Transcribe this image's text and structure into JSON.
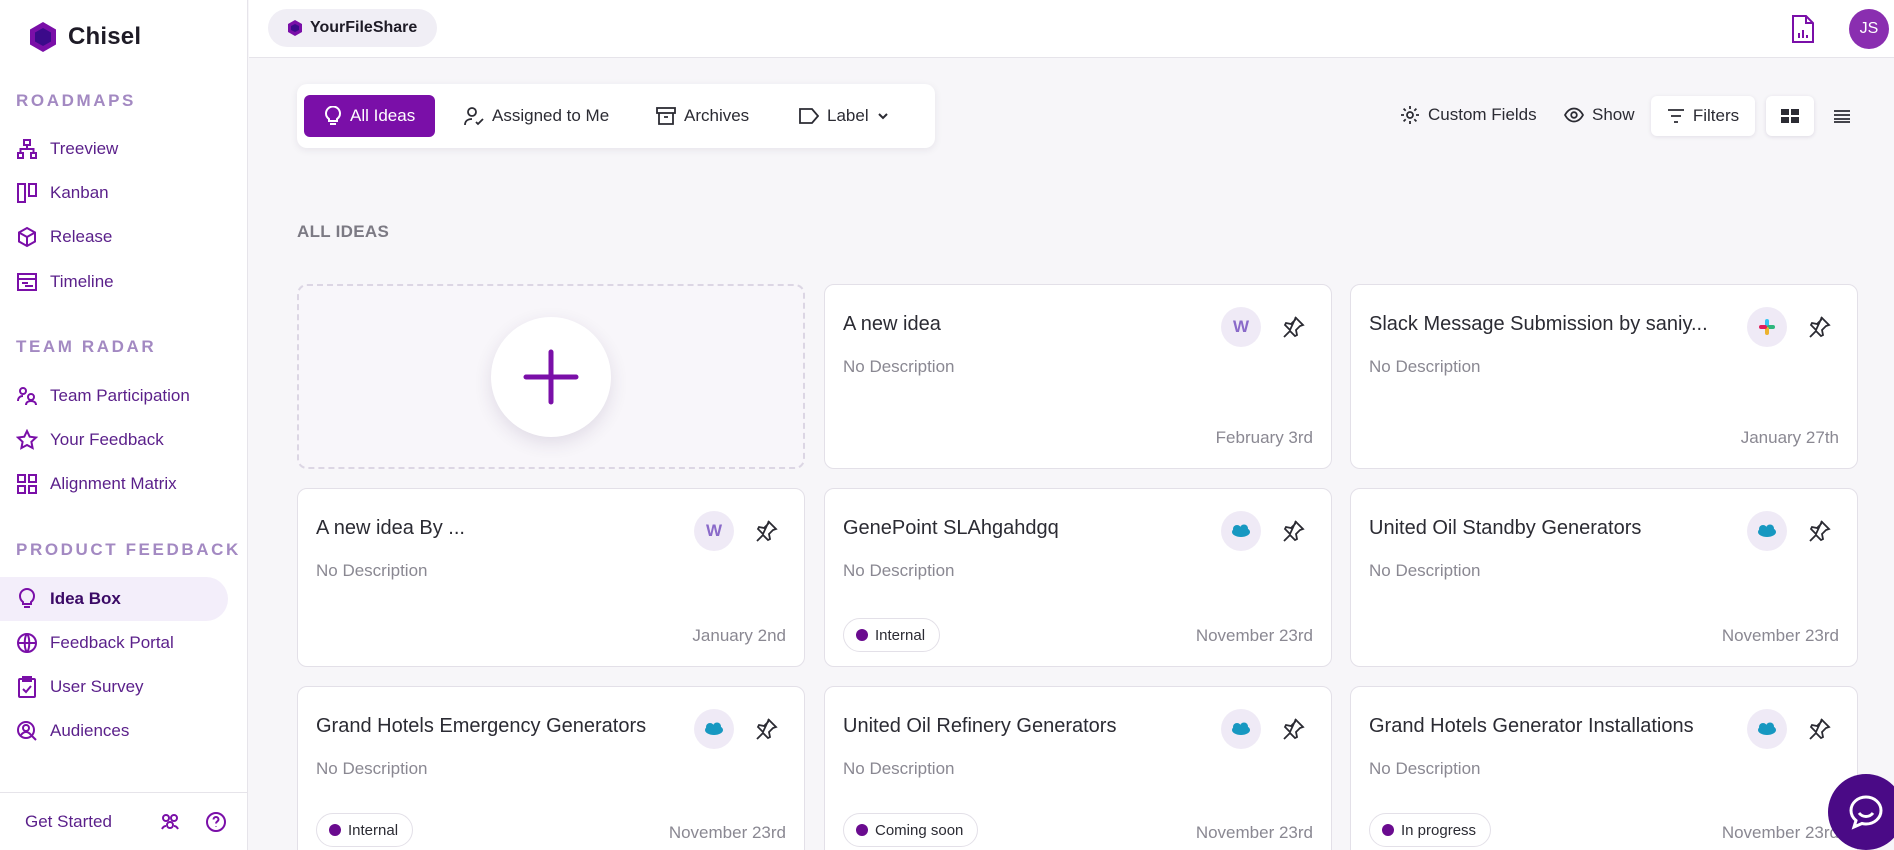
{
  "app": {
    "name": "Chisel",
    "workspace": "YourFileShare",
    "user_initials": "JS"
  },
  "sidebar": {
    "sections": [
      {
        "title": "ROADMAPS",
        "items": [
          {
            "label": "Treeview",
            "icon": "tree-icon"
          },
          {
            "label": "Kanban",
            "icon": "kanban-icon"
          },
          {
            "label": "Release",
            "icon": "box-icon"
          },
          {
            "label": "Timeline",
            "icon": "timeline-icon"
          }
        ]
      },
      {
        "title": "TEAM RADAR",
        "items": [
          {
            "label": "Team Participation",
            "icon": "people-icon"
          },
          {
            "label": "Your Feedback",
            "icon": "star-icon"
          },
          {
            "label": "Alignment Matrix",
            "icon": "grid-icon"
          }
        ]
      },
      {
        "title": "PRODUCT FEEDBACK",
        "items": [
          {
            "label": "Idea Box",
            "icon": "bulb-icon",
            "active": true
          },
          {
            "label": "Feedback Portal",
            "icon": "globe-icon"
          },
          {
            "label": "User Survey",
            "icon": "clipboard-icon"
          },
          {
            "label": "Audiences",
            "icon": "audience-icon"
          }
        ]
      }
    ],
    "footer": {
      "get_started": "Get Started"
    }
  },
  "toolbar": {
    "tabs": [
      {
        "label": "All Ideas",
        "active": true
      },
      {
        "label": "Assigned to Me"
      },
      {
        "label": "Archives"
      },
      {
        "label": "Label"
      }
    ],
    "custom_fields": "Custom Fields",
    "show": "Show",
    "filters": "Filters"
  },
  "main": {
    "section_title": "ALL IDEAS",
    "cards": [
      {
        "title": "A new idea",
        "desc": "No Description",
        "date": "February 3rd",
        "source": "W"
      },
      {
        "title": "Slack Message Submission by saniy...",
        "desc": "No Description",
        "date": "January 27th",
        "source": "slack"
      },
      {
        "title": "A new idea By ...",
        "desc": "No Description",
        "date": "January 2nd",
        "source": "W"
      },
      {
        "title": "GenePoint SLAhgahdgq",
        "desc": "No Description",
        "date": "November 23rd",
        "source": "salesforce",
        "tag": "Internal"
      },
      {
        "title": "United Oil Standby Generators",
        "desc": "No Description",
        "date": "November 23rd",
        "source": "salesforce"
      },
      {
        "title": "Grand Hotels Emergency Generators",
        "desc": "No Description",
        "date": "November 23rd",
        "source": "salesforce",
        "tag": "Internal"
      },
      {
        "title": "United Oil Refinery Generators",
        "desc": "No Description",
        "date": "November 23rd",
        "source": "salesforce",
        "tag": "Coming soon"
      },
      {
        "title": "Grand Hotels Generator Installations",
        "desc": "No Description",
        "date": "November 23rd",
        "source": "salesforce",
        "tag": "In progress"
      }
    ]
  },
  "colors": {
    "accent": "#7a0fa8",
    "accent_dark": "#4a0a86",
    "section_head": "#a389c2"
  }
}
